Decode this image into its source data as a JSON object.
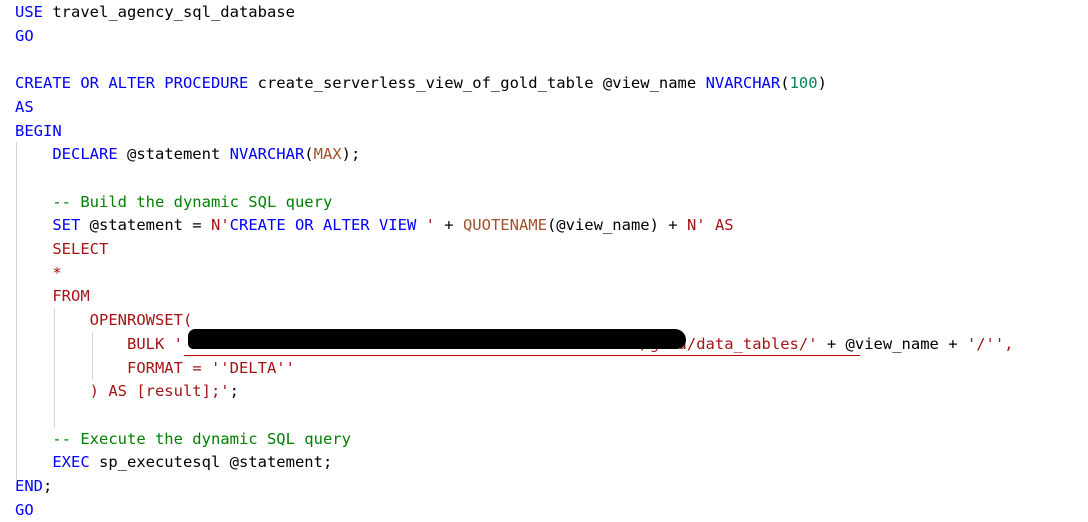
{
  "lines": [
    [
      {
        "c": "kw",
        "t": "USE"
      },
      {
        "c": "pl",
        "t": " travel_agency_sql_database"
      }
    ],
    [
      {
        "c": "kw",
        "t": "GO"
      }
    ],
    [],
    [
      {
        "c": "kw",
        "t": "CREATE OR ALTER PROCEDURE"
      },
      {
        "c": "pl",
        "t": " create_serverless_view_of_gold_table @view_name "
      },
      {
        "c": "kw",
        "t": "NVARCHAR"
      },
      {
        "c": "pl",
        "t": "("
      },
      {
        "c": "num",
        "t": "100"
      },
      {
        "c": "pl",
        "t": ")"
      }
    ],
    [
      {
        "c": "kw",
        "t": "AS"
      }
    ],
    [
      {
        "c": "kw",
        "t": "BEGIN"
      }
    ],
    [
      {
        "c": "pl",
        "t": "    "
      },
      {
        "c": "kw",
        "t": "DECLARE"
      },
      {
        "c": "pl",
        "t": " @statement "
      },
      {
        "c": "kw",
        "t": "NVARCHAR"
      },
      {
        "c": "pl",
        "t": "("
      },
      {
        "c": "fnb",
        "t": "MAX"
      },
      {
        "c": "pl",
        "t": ");"
      }
    ],
    [],
    [
      {
        "c": "pl",
        "t": "    "
      },
      {
        "c": "cm",
        "t": "-- Build the dynamic SQL query"
      }
    ],
    [
      {
        "c": "pl",
        "t": "    "
      },
      {
        "c": "kw",
        "t": "SET"
      },
      {
        "c": "pl",
        "t": " @statement = "
      },
      {
        "c": "str",
        "t": "N'"
      },
      {
        "c": "kw",
        "t": "CREATE OR ALTER VIEW"
      },
      {
        "c": "str",
        "t": " '"
      },
      {
        "c": "pl",
        "t": " + "
      },
      {
        "c": "fnb",
        "t": "QUOTENAME"
      },
      {
        "c": "pl",
        "t": "(@view_name) + "
      },
      {
        "c": "str",
        "t": "N' AS"
      }
    ],
    [
      {
        "c": "pl",
        "t": "    "
      },
      {
        "c": "str",
        "t": "SELECT"
      }
    ],
    [
      {
        "c": "pl",
        "t": "    "
      },
      {
        "c": "str",
        "t": "*"
      }
    ],
    [
      {
        "c": "pl",
        "t": "    "
      },
      {
        "c": "str",
        "t": "FROM"
      }
    ],
    [
      {
        "c": "pl",
        "t": "        "
      },
      {
        "c": "str",
        "t": "OPENROWSET("
      }
    ],
    [
      {
        "c": "pl",
        "t": "            "
      },
      {
        "c": "str",
        "t": "BULK '                                                 /gold/data_tables/'"
      },
      {
        "c": "pl",
        "t": " + @view_name + "
      },
      {
        "c": "str",
        "t": "'/'',"
      }
    ],
    [
      {
        "c": "pl",
        "t": "            "
      },
      {
        "c": "str",
        "t": "FORMAT = ''DELTA''"
      }
    ],
    [
      {
        "c": "pl",
        "t": "        "
      },
      {
        "c": "str",
        "t": ") AS [result];'"
      },
      {
        "c": "pl",
        "t": ";"
      }
    ],
    [],
    [
      {
        "c": "pl",
        "t": "    "
      },
      {
        "c": "cm",
        "t": "-- Execute the dynamic SQL query"
      }
    ],
    [
      {
        "c": "pl",
        "t": "    "
      },
      {
        "c": "kw",
        "t": "EXEC"
      },
      {
        "c": "pl",
        "t": " sp_executesql @statement;"
      }
    ],
    [
      {
        "c": "kw",
        "t": "END"
      },
      {
        "c": "pl",
        "t": ";"
      }
    ],
    [
      {
        "c": "kw",
        "t": "GO"
      }
    ]
  ]
}
